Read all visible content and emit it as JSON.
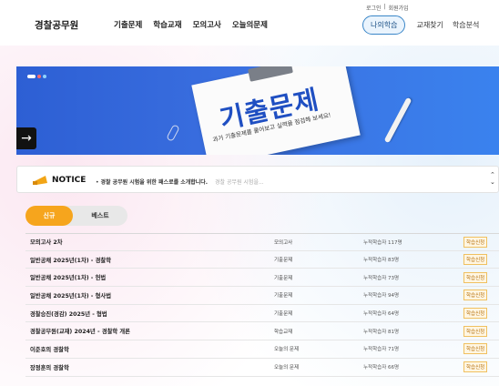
{
  "header": {
    "logo": "경찰공무원",
    "nav": [
      "기출문제",
      "학습교재",
      "모의고사",
      "오늘의문제"
    ],
    "auth": {
      "login": "로그인",
      "separator": "|",
      "signup": "회원가입"
    },
    "user_nav": {
      "my_learning": "나의학습",
      "find_book": "교재찾기",
      "analysis": "학습분석"
    }
  },
  "banner": {
    "title": "기출문제",
    "subtitle": "과거 기출문제를 풀어보고 실력을 점검해 보세요!",
    "next_arrow": "→",
    "colors": {
      "background": "#2f63d8",
      "title": "#1f4fc2"
    }
  },
  "notice": {
    "label": "NOTICE",
    "bullet": "•",
    "text": "경찰 공무원 시험을 위한 패스로를 소개합니다.",
    "text2": "경찰 공무원 시험을..."
  },
  "tabs": {
    "active": "신규",
    "inactive": "베스트"
  },
  "rows": [
    {
      "title": "모의고사 2차",
      "category": "모의고사",
      "count": "누적학습자 117명",
      "action": "학습신청"
    },
    {
      "title": "일반공채 2025년(1차) - 경찰학",
      "category": "기출문제",
      "count": "누적학습자 83명",
      "action": "학습신청"
    },
    {
      "title": "일반공채 2025년(1차) - 헌법",
      "category": "기출문제",
      "count": "누적학습자 73명",
      "action": "학습신청"
    },
    {
      "title": "일반공채 2025년(1차) - 형사법",
      "category": "기출문제",
      "count": "누적학습자 94명",
      "action": "학습신청"
    },
    {
      "title": "경찰승진(경감) 2025년 - 형법",
      "category": "기출문제",
      "count": "누적학습자 64명",
      "action": "학습신청"
    },
    {
      "title": "경찰공무원(교재) 2024년 - 경찰학 개론",
      "category": "학습교재",
      "count": "누적학습자 81명",
      "action": "학습신청"
    },
    {
      "title": "이준호의 경찰학",
      "category": "오늘의 문제",
      "count": "누적학습자 71명",
      "action": "학습신청"
    },
    {
      "title": "장정훈의 경찰학",
      "category": "오늘의 문제",
      "count": "누적학습자 66명",
      "action": "학습신청"
    }
  ],
  "colors": {
    "accent": "#f6a51d",
    "pill_border": "#3a86c8"
  }
}
